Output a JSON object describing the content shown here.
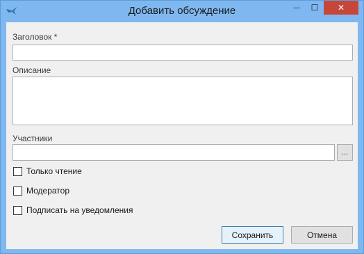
{
  "window": {
    "title": "Добавить обсуждение",
    "minimize_glyph": "—",
    "maximize_glyph": "☐",
    "close_glyph": "✕",
    "app_icon": "bird-app-icon"
  },
  "form": {
    "title_label": "Заголовок *",
    "title_value": "",
    "description_label": "Описание",
    "description_value": "",
    "participants_label": "Участники",
    "participants_value": "",
    "browse_label": "...",
    "checkboxes": [
      {
        "label": "Только чтение",
        "checked": false
      },
      {
        "label": "Модератор",
        "checked": false
      },
      {
        "label": "Подписать на уведомления",
        "checked": false
      }
    ]
  },
  "buttons": {
    "save_label": "Сохранить",
    "cancel_label": "Отмена"
  },
  "colors": {
    "titlebar": "#7fb8f0",
    "close_button": "#c7463a",
    "client_background": "#f0f0f0"
  }
}
